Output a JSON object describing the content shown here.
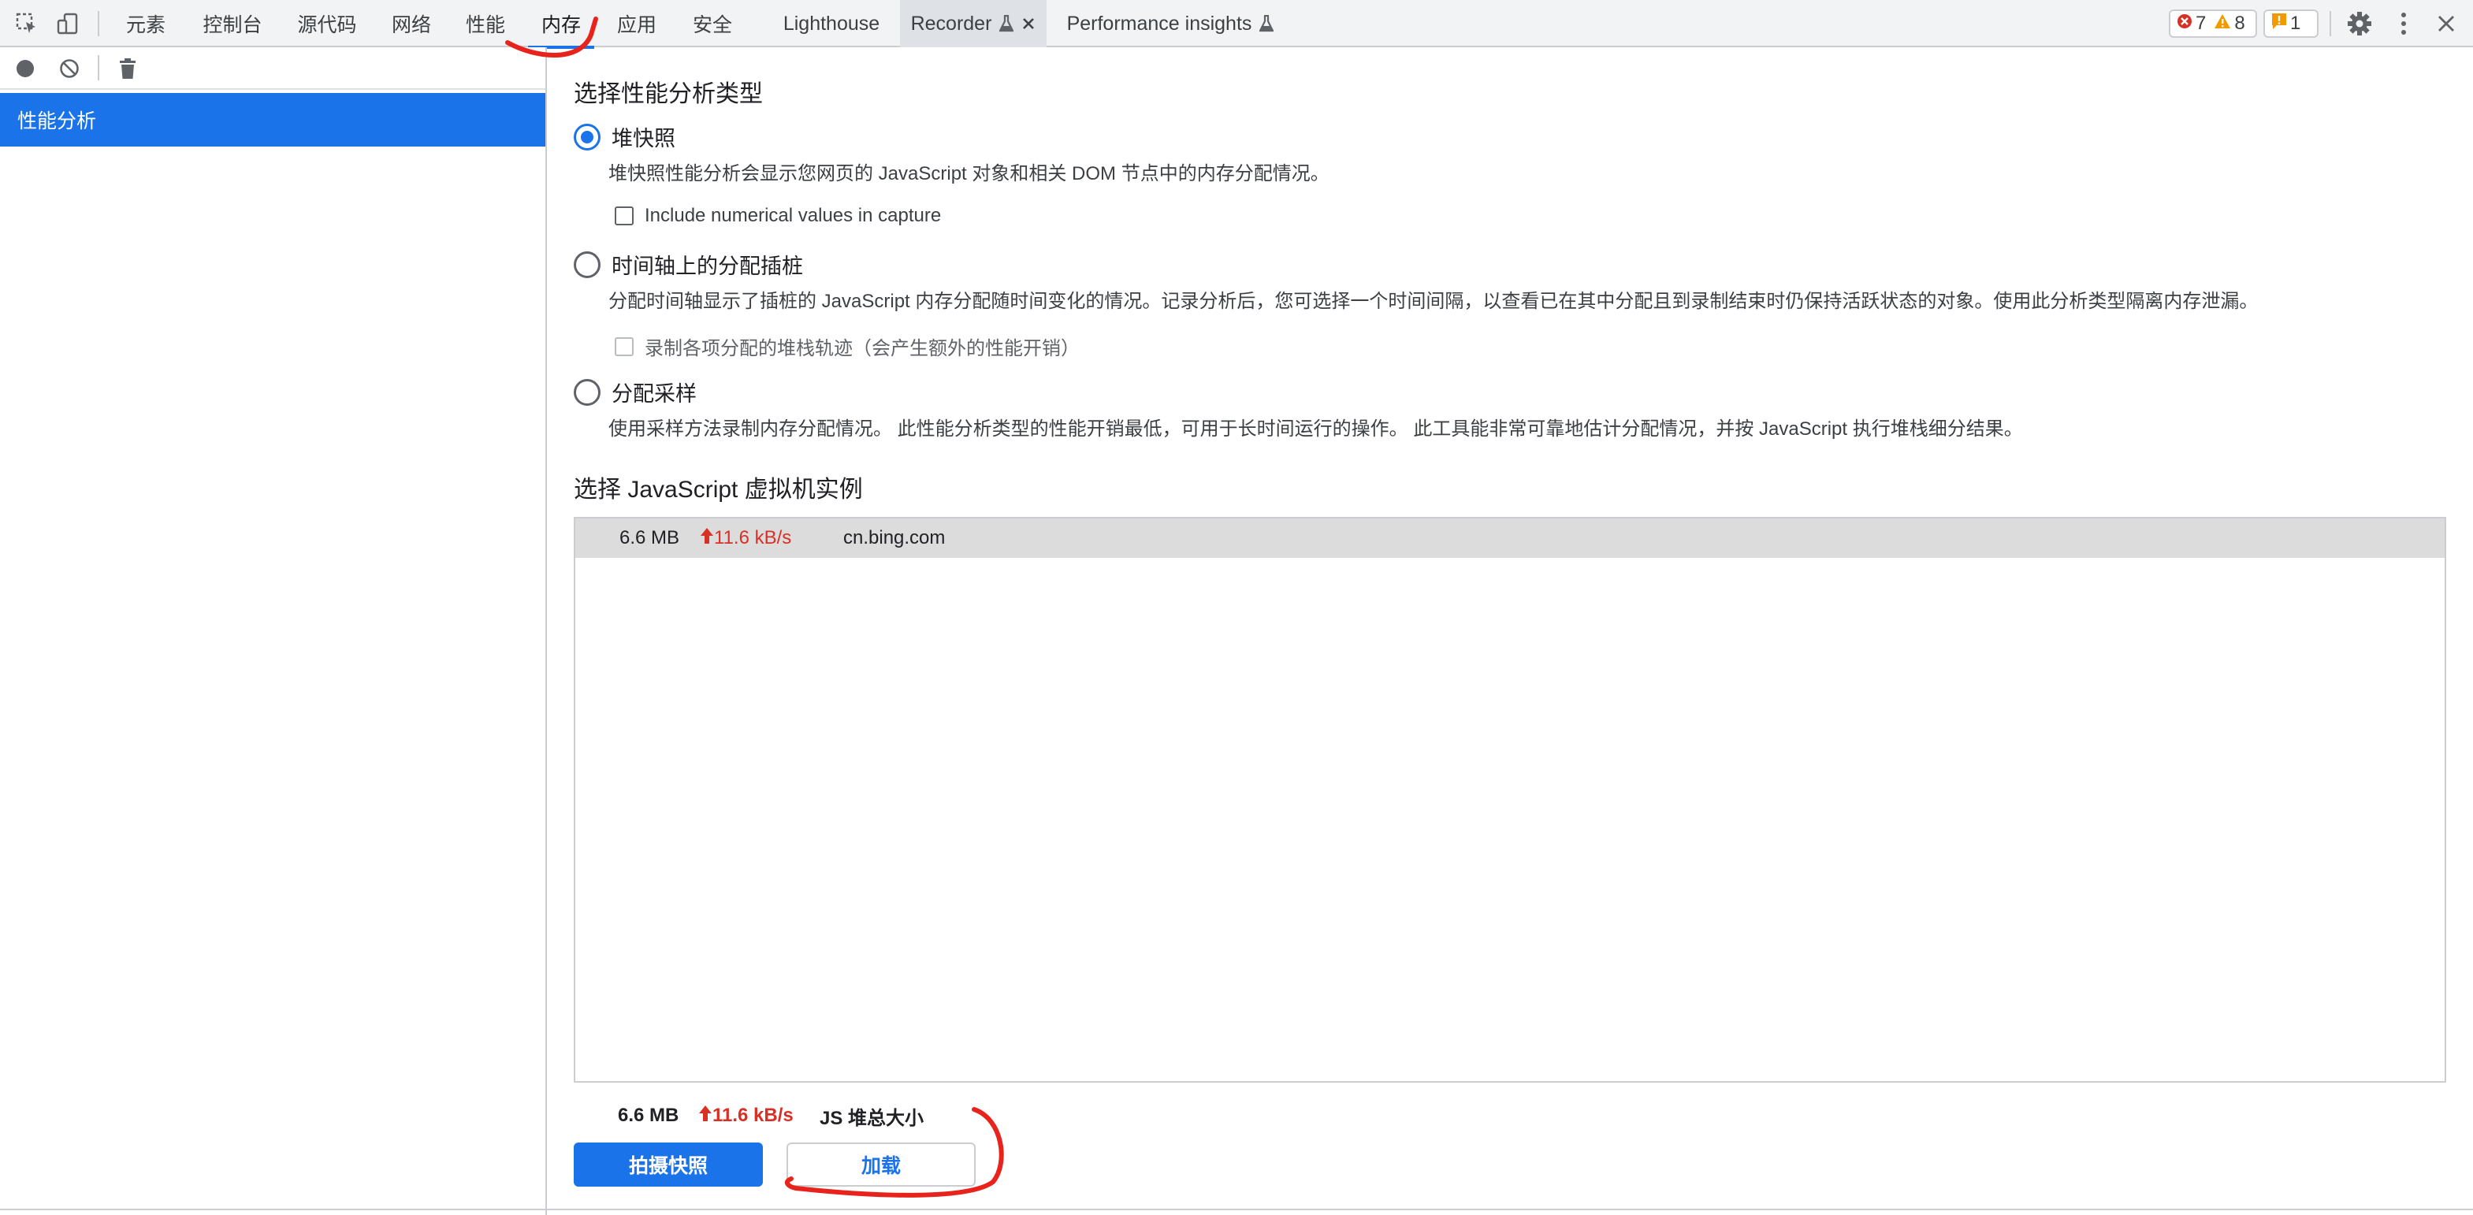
{
  "toolbar": {
    "inspect_icon": "inspect-element-icon",
    "device_icon": "device-toolbar-icon",
    "tabs": [
      {
        "label": "元素"
      },
      {
        "label": "控制台"
      },
      {
        "label": "源代码"
      },
      {
        "label": "网络"
      },
      {
        "label": "性能"
      },
      {
        "label": "内存",
        "active": true
      },
      {
        "label": "应用"
      },
      {
        "label": "安全"
      },
      {
        "label": "Lighthouse"
      },
      {
        "label": "Recorder",
        "experimental": true,
        "closable": true
      },
      {
        "label": "Performance insights",
        "experimental": true
      }
    ],
    "badges": {
      "errors": "7",
      "warnings": "8",
      "issues": "1"
    },
    "icons": [
      "settings-gear-icon",
      "more-vertical-icon",
      "close-devtools-icon"
    ]
  },
  "sidebar": {
    "toolbar_icons": [
      "record-icon",
      "clear-icon",
      "garbage-collect-icon"
    ],
    "items": [
      {
        "label": "性能分析",
        "selected": true
      }
    ]
  },
  "main": {
    "profile_type_title": "选择性能分析类型",
    "options": [
      {
        "label": "堆快照",
        "checked": true,
        "description": "堆快照性能分析会显示您网页的 JavaScript 对象和相关 DOM 节点中的内存分配情况。",
        "checkbox": {
          "label": "Include numerical values in capture",
          "checked": false,
          "disabled": false
        }
      },
      {
        "label": "时间轴上的分配插桩",
        "checked": false,
        "description": "分配时间轴显示了插桩的 JavaScript 内存分配随时间变化的情况。记录分析后，您可选择一个时间间隔，以查看已在其中分配且到录制结束时仍保持活跃状态的对象。使用此分析类型隔离内存泄漏。",
        "checkbox": {
          "label": "录制各项分配的堆栈轨迹（会产生额外的性能开销）",
          "checked": false,
          "disabled": true
        }
      },
      {
        "label": "分配采样",
        "checked": false,
        "description": "使用采样方法录制内存分配情况。 此性能分析类型的性能开销最低，可用于长时间运行的操作。 此工具能非常可靠地估计分配情况，并按 JavaScript 执行堆栈细分结果。"
      }
    ],
    "vm_title": "选择 JavaScript 虚拟机实例",
    "vm_instances": [
      {
        "size": "6.6 MB",
        "rate": "11.6 kB/s",
        "host": "cn.bing.com"
      }
    ],
    "summary": {
      "size": "6.6 MB",
      "rate": "11.6 kB/s",
      "label": "JS 堆总大小"
    },
    "take_snapshot_label": "拍摄快照",
    "load_label": "加载"
  },
  "colors": {
    "accent": "#1a73e8",
    "annotation": "#e8231c",
    "rate_up": "#d93025"
  }
}
